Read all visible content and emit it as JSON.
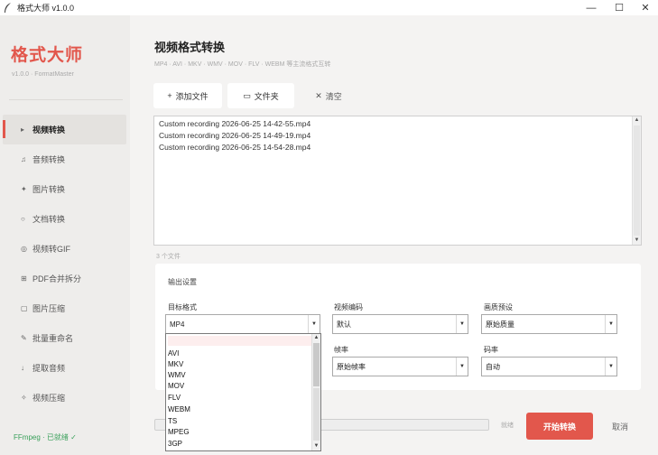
{
  "window": {
    "title": "格式大师 v1.0.0",
    "min_glyph": "—",
    "max_glyph": "☐",
    "close_glyph": "✕",
    "icon": "feather-icon"
  },
  "sidebar": {
    "brand": "格式大师",
    "version": "v1.0.0 · FormatMaster",
    "items": [
      {
        "icon": "▸",
        "label": "视频转换",
        "active": true
      },
      {
        "icon": "♫",
        "label": "音频转换"
      },
      {
        "icon": "✦",
        "label": "图片转换"
      },
      {
        "icon": "○",
        "label": "文档转换"
      },
      {
        "icon": "◎",
        "label": "视频转GIF"
      },
      {
        "icon": "⊞",
        "label": "PDF合并拆分"
      },
      {
        "icon": "▢",
        "label": "图片压缩"
      },
      {
        "icon": "✎",
        "label": "批量重命名"
      },
      {
        "icon": "↓",
        "label": "提取音频"
      },
      {
        "icon": "✧",
        "label": "视频压缩"
      }
    ],
    "ffmpeg_status": "FFmpeg · 已就绪 ✓"
  },
  "main": {
    "title": "视频格式转换",
    "subtitle": "MP4 · AVI · MKV · WMV · MOV · FLV · WEBM 等主流格式互转",
    "toolbar": {
      "add_icon": "+",
      "add_label": "添加文件",
      "folder_icon": "▭",
      "folder_label": "文件夹",
      "clear_icon": "✕",
      "clear_label": "清空"
    },
    "files": [
      "Custom recording 2026-06-25 14-42-55.mp4",
      "Custom recording 2026-06-25 14-49-19.mp4",
      "Custom recording 2026-06-25 14-54-28.mp4"
    ],
    "file_count": "3 个文件",
    "settings": {
      "title": "输出设置",
      "target_format_label": "目标格式",
      "target_format_value": "MP4",
      "video_codec_label": "视频编码",
      "video_codec_value": "默认",
      "quality_label": "画质预设",
      "quality_value": "原始质量",
      "framerate_label": "帧率",
      "framerate_value": "原始帧率",
      "bitrate_label": "码率",
      "bitrate_value": "自动"
    },
    "format_options": [
      "",
      "AVI",
      "MKV",
      "WMV",
      "MOV",
      "FLV",
      "WEBM",
      "TS",
      "MPEG",
      "3GP"
    ],
    "status_text": "就绪",
    "start_label": "开始转换",
    "cancel_label": "取消",
    "progress": 0
  },
  "colors": {
    "accent": "#e2574c",
    "ready_green": "#3aa05b"
  }
}
